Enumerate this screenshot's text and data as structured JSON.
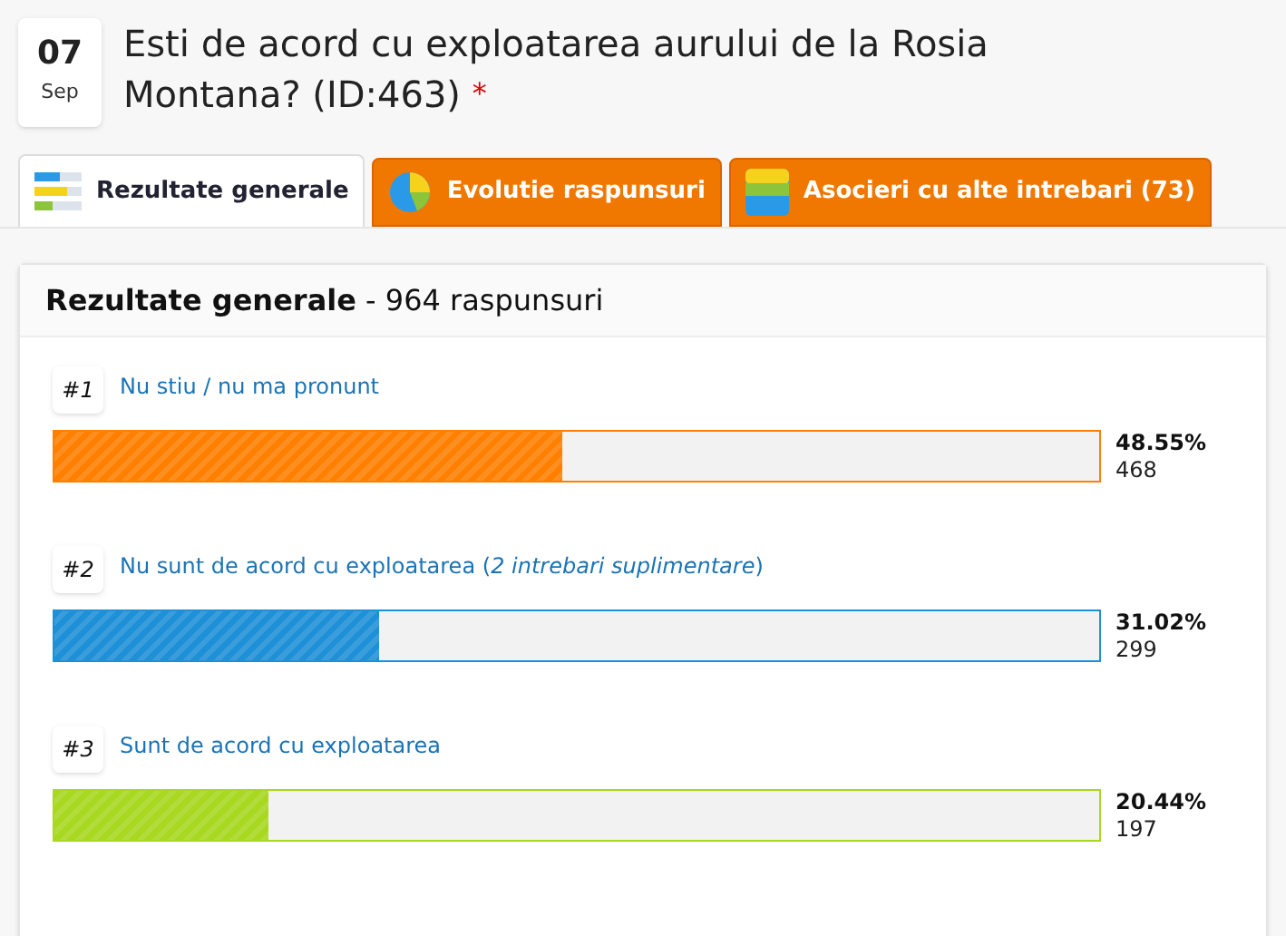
{
  "date": {
    "day": "07",
    "month": "Sep"
  },
  "question": {
    "title": "Esti de acord cu exploatarea aurului de la Rosia Montana? (ID:463)",
    "required_mark": "*"
  },
  "tabs": [
    {
      "label": "Rezultate generale",
      "selected": true,
      "kind": "bars"
    },
    {
      "label": "Evolutie raspunsuri",
      "selected": false,
      "kind": "pie"
    },
    {
      "label": "Asocieri cu alte intrebari (73)",
      "selected": false,
      "kind": "layers"
    }
  ],
  "panel": {
    "title": "Rezultate generale",
    "subtitle": "- 964 raspunsuri"
  },
  "answers": [
    {
      "rank": "#1",
      "label": "Nu stiu / nu ma pronunt",
      "color": "#ff7f00",
      "level": 0.4855,
      "percent": "48.55%",
      "count": "468"
    },
    {
      "rank": "#2",
      "label": "Nu sunt de acord cu exploatarea",
      "link_open": "(",
      "link": "2 intrebari suplimentare",
      "link_close": ")",
      "color": "#1e90d8",
      "level": 0.3102,
      "percent": "31.02%",
      "count": "299"
    },
    {
      "rank": "#3",
      "label": "Sunt de acord cu exploatarea",
      "color": "#a8d820",
      "level": 0.2044,
      "percent": "20.44%",
      "count": "197"
    }
  ]
}
